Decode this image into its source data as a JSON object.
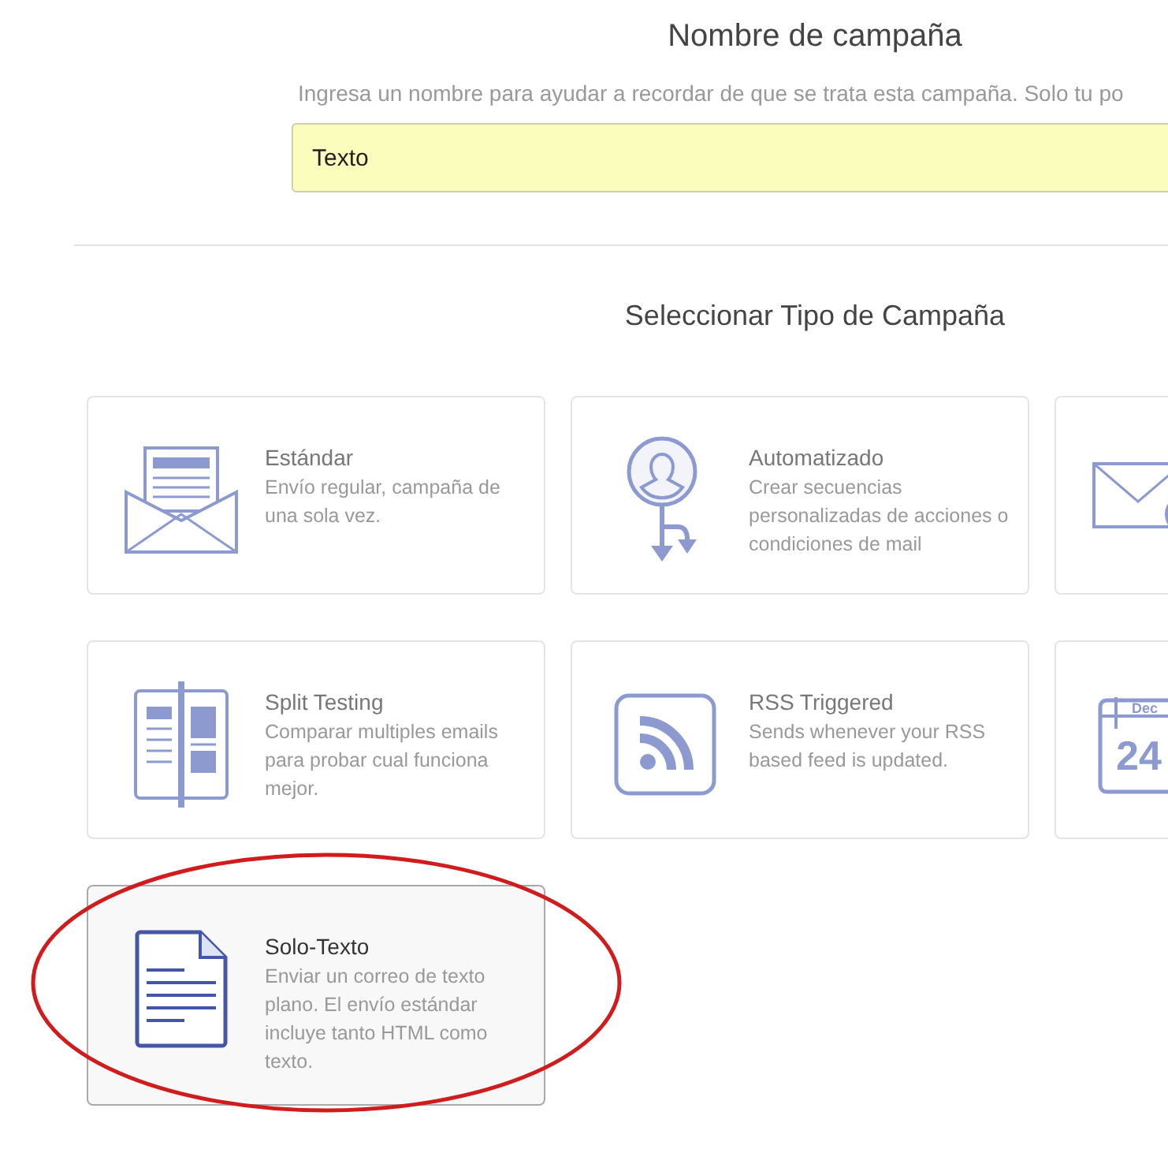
{
  "campaign_name": {
    "title": "Nombre de campaña",
    "description": "Ingresa un nombre para ayudar a recordar de que se trata esta campaña. Solo tu po",
    "value": "Texto"
  },
  "campaign_type": {
    "title": "Seleccionar Tipo de Campaña",
    "options": [
      {
        "kind": "envelope",
        "title": "Estándar",
        "description": "Envío regular, campaña de una sola vez.",
        "selected": false
      },
      {
        "kind": "automation",
        "title": "Automatizado",
        "description": "Crear secuencias personalizadas de acciones o condiciones de mail",
        "selected": false
      },
      {
        "kind": "envelope-clock",
        "selected": false
      },
      {
        "kind": "split",
        "title": "Split Testing",
        "description": "Comparar multiples emails para probar cual funciona mejor.",
        "selected": false
      },
      {
        "kind": "rss",
        "title": "RSS Triggered",
        "description": "Sends whenever your RSS based feed is updated.",
        "selected": false
      },
      {
        "kind": "calendar",
        "month": "Dec",
        "day": "24",
        "selected": false
      },
      {
        "kind": "document",
        "title": "Solo-Texto",
        "description": "Enviar un correo de texto plano. El envío estándar incluye tanto HTML como texto.",
        "selected": true
      }
    ]
  }
}
